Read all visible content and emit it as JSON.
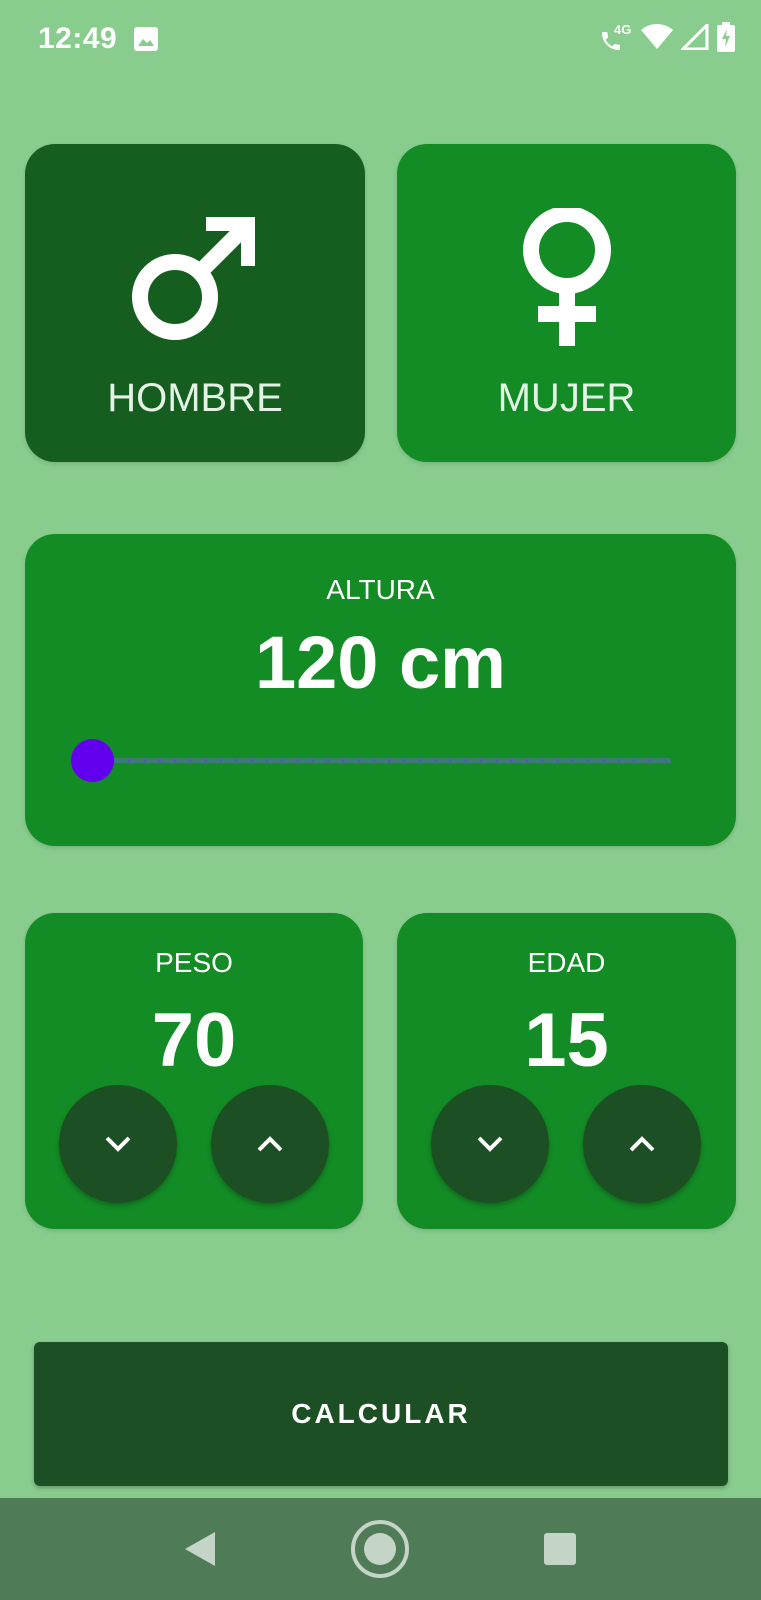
{
  "status_bar": {
    "time": "12:49",
    "network_label": "4G",
    "icons": [
      "image-icon",
      "wifi-calling-icon",
      "wifi-icon",
      "signal-icon",
      "battery-charging-icon"
    ]
  },
  "gender": {
    "male_label": "HOMBRE",
    "female_label": "MUJER",
    "selected": "male"
  },
  "height": {
    "label": "ALTURA",
    "value_display": "120 cm",
    "slider_value": 120
  },
  "weight": {
    "label": "PESO",
    "value": "70"
  },
  "age": {
    "label": "EDAD",
    "value": "15"
  },
  "calculate_label": "CALCULAR",
  "colors": {
    "background": "#88CC8E",
    "card": "#138C25",
    "card_selected": "#165E20",
    "button_dark": "#1C4F23",
    "slider_thumb": "#6200EE",
    "nav_bar": "#4F7C57"
  },
  "nav_bar": {
    "icons": [
      "back-icon",
      "home-icon",
      "recents-icon"
    ]
  }
}
